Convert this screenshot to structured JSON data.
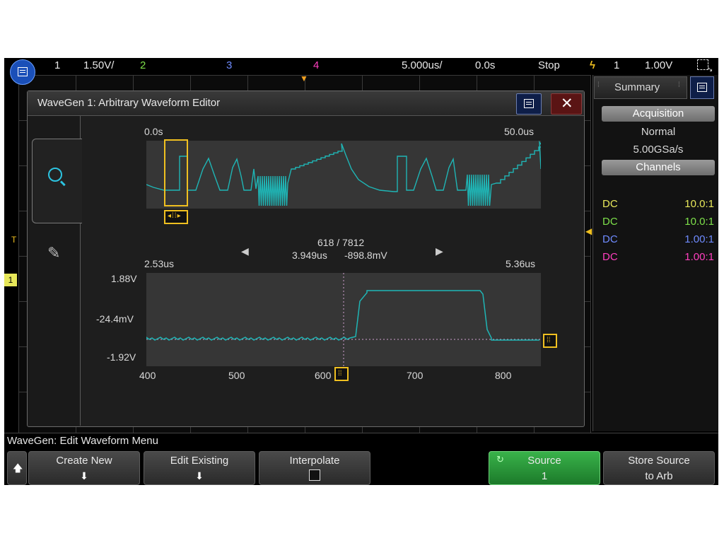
{
  "topbar": {
    "ch1_num": "1",
    "ch1_scale": "1.50V/",
    "ch2_num": "2",
    "ch3_num": "3",
    "ch4_num": "4",
    "timebase": "5.000us/",
    "delay": "0.0s",
    "run_state": "Stop",
    "trig_channel": "1",
    "trig_level": "1.00V"
  },
  "editor": {
    "title": "WaveGen 1: Arbitrary Waveform Editor",
    "overview": {
      "start_time": "0.0s",
      "end_time": "50.0us"
    },
    "position": {
      "index": "618 / 7812",
      "time": "3.949us",
      "value": "-898.8mV"
    },
    "detail": {
      "start_time": "2.53us",
      "end_time": "5.36us",
      "y_labels": [
        "1.88V",
        "-24.4mV",
        "-1.92V"
      ],
      "x_labels": [
        "400",
        "500",
        "600",
        "700",
        "800"
      ]
    }
  },
  "summary": {
    "tab_label": "Summary",
    "acquisition_label": "Acquisition",
    "mode": "Normal",
    "sample_rate": "5.00GSa/s",
    "channels_label": "Channels",
    "channels": [
      {
        "coupling": "DC",
        "probe": "10.0:1",
        "color": "#e8e85a"
      },
      {
        "coupling": "DC",
        "probe": "10.0:1",
        "color": "#7ee04a"
      },
      {
        "coupling": "DC",
        "probe": "1.00:1",
        "color": "#6f8bff"
      },
      {
        "coupling": "DC",
        "probe": "1.00:1",
        "color": "#ff3fbf"
      }
    ]
  },
  "menu": {
    "title": "WaveGen: Edit Waveform Menu",
    "create_new": "Create New",
    "edit_existing": "Edit Existing",
    "interpolate": "Interpolate",
    "source_label": "Source",
    "source_value": "1",
    "store_line1": "Store Source",
    "store_line2": "to Arb"
  },
  "colors": {
    "trace": "#1fb5b5",
    "cursor": "#f0c020",
    "ch1": "#e8e85a",
    "ch2": "#7ee04a",
    "ch3": "#6f8bff",
    "ch4": "#ff3fbf",
    "source_button": "#2a9a3a"
  }
}
